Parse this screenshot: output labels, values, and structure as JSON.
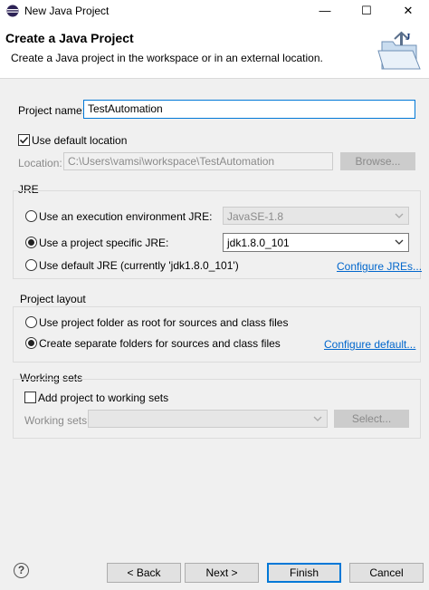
{
  "window": {
    "title": "New Java Project",
    "minimize_glyph": "—",
    "maximize_glyph": "☐",
    "close_glyph": "✕"
  },
  "header": {
    "title": "Create a Java Project",
    "description": "Create a Java project in the workspace or in an external location.",
    "icon": "java-project-folder-icon"
  },
  "project": {
    "name_label": "Project name:",
    "name_value": "TestAutomation",
    "use_default_location_label": "Use default location",
    "use_default_location_checked": true,
    "location_label": "Location:",
    "location_value": "C:\\Users\\vamsi\\workspace\\TestAutomation",
    "browse_label": "Browse..."
  },
  "jre": {
    "group_label": "JRE",
    "option_exec_env_label": "Use an execution environment JRE:",
    "exec_env_value": "JavaSE-1.8",
    "option_project_specific_label": "Use a project specific JRE:",
    "project_specific_value": "jdk1.8.0_101",
    "option_default_label": "Use default JRE (currently 'jdk1.8.0_101')",
    "configure_link": "Configure JREs...",
    "selected": "project_specific"
  },
  "layout": {
    "group_label": "Project layout",
    "option_root_label": "Use project folder as root for sources and class files",
    "option_separate_label": "Create separate folders for sources and class files",
    "configure_link": "Configure default...",
    "selected": "separate"
  },
  "working_sets": {
    "group_label": "Working sets",
    "add_label": "Add project to working sets",
    "add_checked": false,
    "sets_label": "Working sets:",
    "select_label": "Select..."
  },
  "footer": {
    "help_glyph": "?",
    "back_label": "< Back",
    "next_label": "Next >",
    "finish_label": "Finish",
    "cancel_label": "Cancel"
  },
  "colors": {
    "accent": "#0078d7",
    "link": "#0066cc"
  }
}
